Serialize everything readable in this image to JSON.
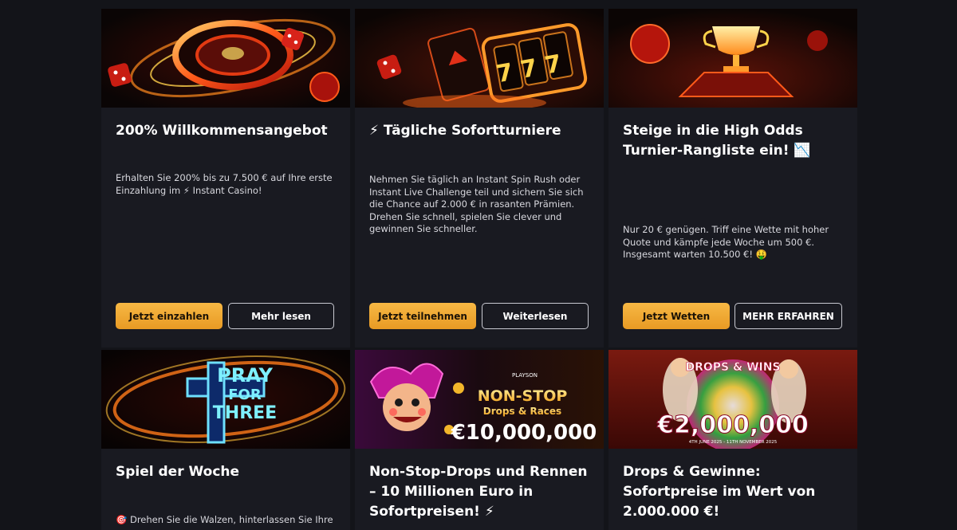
{
  "cards": [
    {
      "title": "200% Willkommensangebot",
      "description": "Erhalten Sie 200% bis zu 7.500 € auf Ihre erste Einzahlung im ⚡ Instant Casino!",
      "primary": "Jetzt einzahlen",
      "secondary": "Mehr lesen",
      "banner_icon": "roulette-wheel-icon"
    },
    {
      "title": "⚡ Tägliche Sofortturniere",
      "description": "Nehmen Sie täglich an Instant Spin Rush oder Instant Live Challenge teil und sichern Sie sich die Chance auf 2.000 € in rasanten Prämien. Drehen Sie schnell, spielen Sie clever und gewinnen Sie schneller.",
      "primary": "Jetzt teilnehmen",
      "secondary": "Weiterlesen",
      "banner_icon": "slot-machine-icon",
      "banner_text": "777"
    },
    {
      "title": "Steige in die High Odds Turnier-Rangliste ein! 📉",
      "description": "Nur 20 € genügen. Triff eine Wette mit hoher Quote und kämpfe jede Woche um 500 €. Insgesamt warten 10.500 €! 🤑",
      "primary": "Jetzt Wetten",
      "secondary": "MEHR ERFAHREN",
      "banner_icon": "trophy-icon"
    },
    {
      "title": "Spiel der Woche",
      "description": "🎯 Drehen Sie die Walzen, hinterlassen Sie Ihre",
      "banner_icon": "game-logo-icon",
      "banner_text": [
        "PRAY",
        "FOR",
        "THREE"
      ]
    },
    {
      "title": "Non-Stop-Drops und Rennen – 10 Millionen Euro in Sofortpreisen! ⚡",
      "banner_icon": "jester-icon",
      "banner_text": {
        "brand": "PLAYSON",
        "headline": "NON-STOP",
        "sub": "Drops & Races",
        "amount": "€10,000,000"
      }
    },
    {
      "title": "Drops & Gewinne: Sofortpreise im Wert von 2.000.000 €!",
      "banner_icon": "goddess-icon",
      "banner_text": {
        "headline": "DROPS & WINS",
        "amount": "€2,000,000",
        "dates": "4TH JUNE 2025 - 11TH NOVEMBER 2025"
      }
    }
  ],
  "colors": {
    "page_bg": "#131419",
    "card_bg": "#191a21",
    "accent": "#f2a93b",
    "button_text_dark": "#1b1206"
  }
}
